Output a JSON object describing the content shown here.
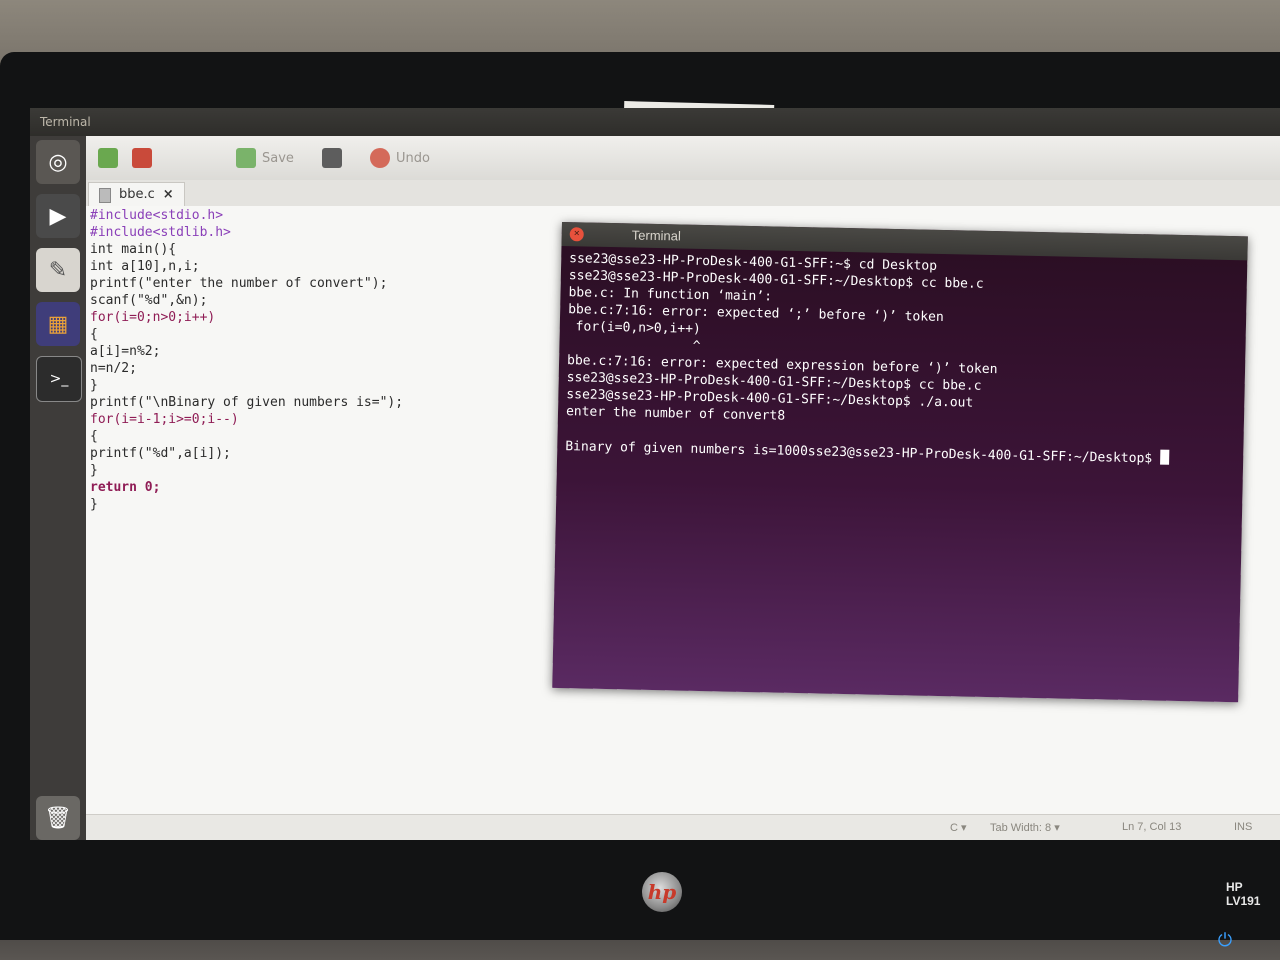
{
  "topbar": {
    "title": "Terminal"
  },
  "toolbar": {
    "save_label": "Save",
    "undo_label": "Undo"
  },
  "tab": {
    "filename": "bbe.c",
    "close_glyph": "×"
  },
  "code": [
    "#include<stdio.h>",
    "#include<stdlib.h>",
    "int main(){",
    "int a[10],n,i;",
    "printf(\"enter the number of convert\");",
    "scanf(\"%d\",&n);",
    "for(i=0;n>0;i++)",
    "{",
    "a[i]=n%2;",
    "n=n/2;",
    "}",
    "printf(\"\\nBinary of given numbers is=\");",
    "for(i=i-1;i>=0;i--)",
    "{",
    "printf(\"%d\",a[i]);",
    "}",
    "return 0;",
    "}"
  ],
  "statusbar": {
    "lang": "C ▾",
    "tab_width": "Tab Width: 8 ▾",
    "position": "Ln 7, Col 13",
    "mode": "INS"
  },
  "terminal": {
    "title": "Terminal",
    "lines": [
      "sse23@sse23-HP-ProDesk-400-G1-SFF:~$ cd Desktop",
      "sse23@sse23-HP-ProDesk-400-G1-SFF:~/Desktop$ cc bbe.c",
      "bbe.c: In function ‘main’:",
      "bbe.c:7:16: error: expected ‘;’ before ‘)’ token",
      " for(i=0,n>0,i++)",
      "                ^",
      "bbe.c:7:16: error: expected expression before ‘)’ token",
      "sse23@sse23-HP-ProDesk-400-G1-SFF:~/Desktop$ cc bbe.c",
      "sse23@sse23-HP-ProDesk-400-G1-SFF:~/Desktop$ ./a.out",
      "enter the number of convert8",
      "",
      "Binary of given numbers is=1000sse23@sse23-HP-ProDesk-400-G1-SFF:~/Desktop$ "
    ]
  },
  "monitor": {
    "brand": "hp",
    "model": "HP LV191",
    "power_glyph": "⏻"
  },
  "icons": [
    "ubuntu-logo-icon",
    "media-player-icon",
    "text-editor-icon",
    "software-center-icon",
    "terminal-icon",
    "trash-icon"
  ]
}
